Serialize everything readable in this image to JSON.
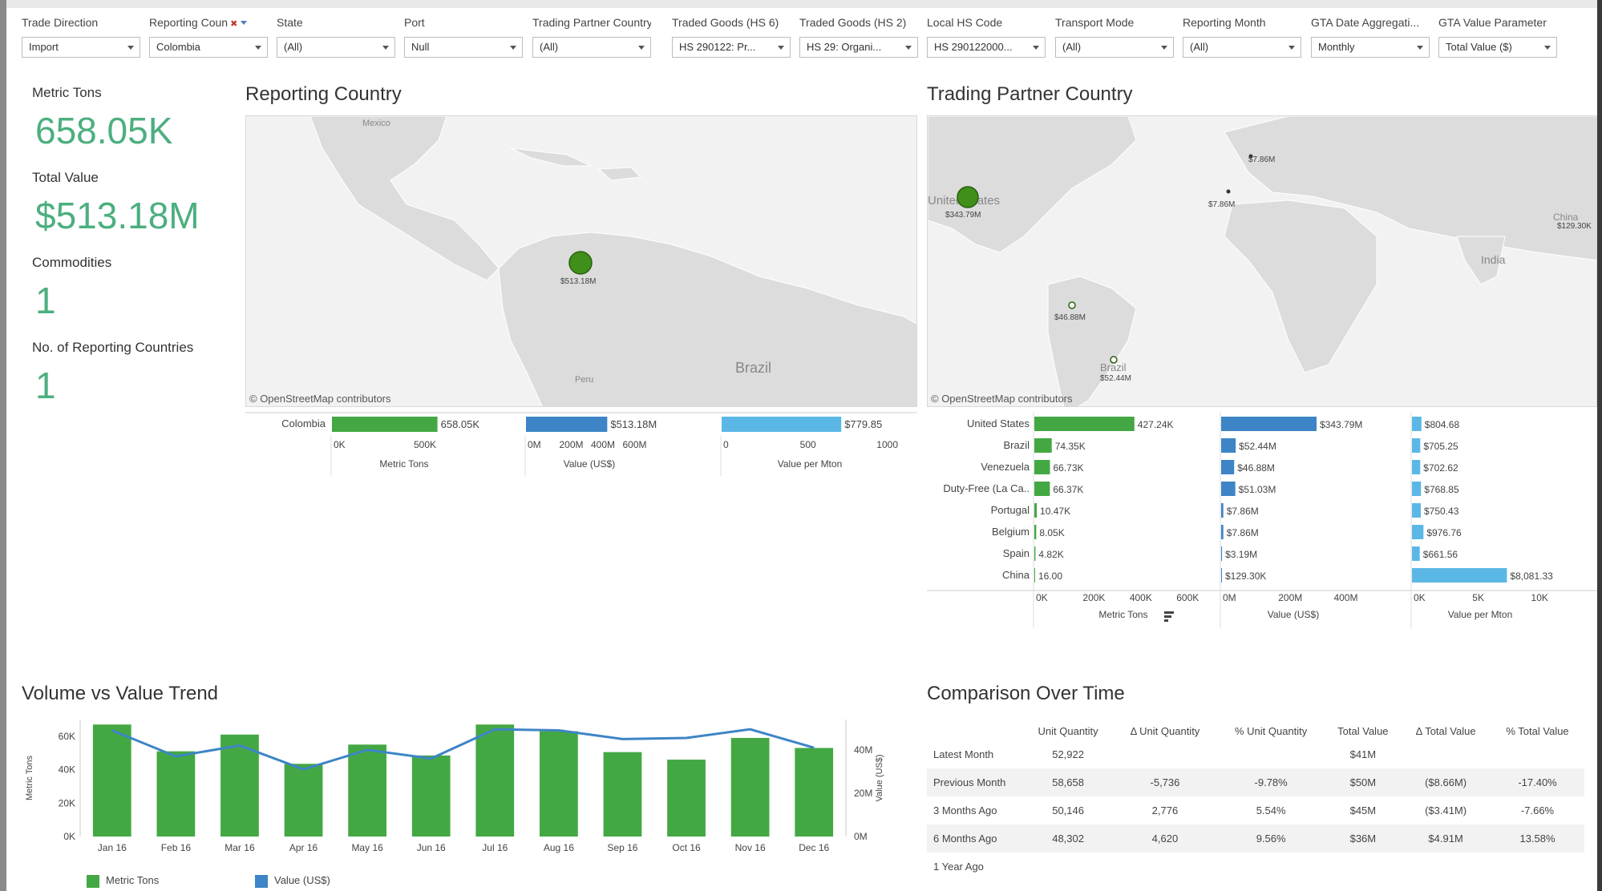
{
  "filters": [
    {
      "label": "Trade Direction",
      "value": "Import"
    },
    {
      "label": "Reporting Coun",
      "value": "Colombia"
    },
    {
      "label": "State",
      "value": "(All)"
    },
    {
      "label": "Port",
      "value": "Null"
    },
    {
      "label": "Trading Partner Country",
      "value": "(All)"
    },
    {
      "label": "Traded Goods (HS 6)",
      "value": "HS 290122: Pr..."
    },
    {
      "label": "Traded Goods (HS 2)",
      "value": "HS 29: Organi..."
    },
    {
      "label": "Local HS Code",
      "value": "HS 290122000..."
    },
    {
      "label": "Transport Mode",
      "value": "(All)"
    },
    {
      "label": "Reporting Month",
      "value": "(All)"
    },
    {
      "label": "GTA Date Aggregati...",
      "value": "Monthly"
    },
    {
      "label": "GTA Value Parameter",
      "value": "Total Value ($)"
    }
  ],
  "kpis": {
    "metric_tons_label": "Metric Tons",
    "metric_tons_value": "658.05K",
    "total_value_label": "Total Value",
    "total_value_value": "$513.18M",
    "commodities_label": "Commodities",
    "commodities_value": "1",
    "reporting_countries_label": "No. of Reporting Countries",
    "reporting_countries_value": "1"
  },
  "reporting_map": {
    "title": "Reporting Country",
    "credit": "© OpenStreetMap contributors",
    "labels": {
      "mexico": "Mexico",
      "brazil": "Brazil",
      "peru": "Peru"
    },
    "marker_label": "$513.18M"
  },
  "partner_map": {
    "title": "Trading Partner Country",
    "credit": "© OpenStreetMap contributors",
    "labels": {
      "us": "United States",
      "brazil": "Brazil",
      "china": "China",
      "india": "India"
    },
    "markers": {
      "us": "$343.79M",
      "ven": "$46.88M",
      "bra": "$52.44M",
      "por": "$7.86M",
      "bel": "$7.86M",
      "chn": "$129.30K"
    }
  },
  "reporting_bars": {
    "row": "Colombia",
    "metric_tons": 658050,
    "metric_tons_label": "658.05K",
    "value": 513180000,
    "value_label": "$513.18M",
    "per_mton": 779.85,
    "per_mton_label": "$779.85",
    "axes": [
      {
        "title": "Metric Tons",
        "ticks": [
          "0K",
          "500K"
        ]
      },
      {
        "title": "Value (US$)",
        "ticks": [
          "0M",
          "200M",
          "400M",
          "600M"
        ]
      },
      {
        "title": "Value per Mton",
        "ticks": [
          "0",
          "500",
          "1000"
        ]
      }
    ]
  },
  "partner_bars": {
    "rows": [
      {
        "country": "United States",
        "tons": 427240,
        "tons_label": "427.24K",
        "value": 343790000,
        "value_label": "$343.79M",
        "per": 804.68,
        "per_label": "$804.68"
      },
      {
        "country": "Brazil",
        "tons": 74350,
        "tons_label": "74.35K",
        "value": 52440000,
        "value_label": "$52.44M",
        "per": 705.25,
        "per_label": "$705.25"
      },
      {
        "country": "Venezuela",
        "tons": 66730,
        "tons_label": "66.73K",
        "value": 46880000,
        "value_label": "$46.88M",
        "per": 702.62,
        "per_label": "$702.62"
      },
      {
        "country": "Duty-Free (La Ca..",
        "tons": 66370,
        "tons_label": "66.37K",
        "value": 51030000,
        "value_label": "$51.03M",
        "per": 768.85,
        "per_label": "$768.85"
      },
      {
        "country": "Portugal",
        "tons": 10470,
        "tons_label": "10.47K",
        "value": 7860000,
        "value_label": "$7.86M",
        "per": 750.43,
        "per_label": "$750.43"
      },
      {
        "country": "Belgium",
        "tons": 8050,
        "tons_label": "8.05K",
        "value": 7860000,
        "value_label": "$7.86M",
        "per": 976.76,
        "per_label": "$976.76"
      },
      {
        "country": "Spain",
        "tons": 4820,
        "tons_label": "4.82K",
        "value": 3190000,
        "value_label": "$3.19M",
        "per": 661.56,
        "per_label": "$661.56"
      },
      {
        "country": "China",
        "tons": 16,
        "tons_label": "16.00",
        "value": 129300,
        "value_label": "$129.30K",
        "per": 8081.33,
        "per_label": "$8,081.33"
      }
    ],
    "axes": [
      {
        "title": "Metric Tons",
        "ticks": [
          "0K",
          "200K",
          "400K",
          "600K"
        ]
      },
      {
        "title": "Value (US$)",
        "ticks": [
          "0M",
          "200M",
          "400M"
        ]
      },
      {
        "title": "Value per Mton",
        "ticks": [
          "0K",
          "5K",
          "10K"
        ]
      }
    ]
  },
  "trend": {
    "title": "Volume vs Value Trend",
    "chart_data": {
      "type": "bar",
      "categories": [
        "Jan 16",
        "Feb 16",
        "Mar 16",
        "Apr 16",
        "May 16",
        "Jun 16",
        "Jul 16",
        "Aug 16",
        "Sep 16",
        "Oct 16",
        "Nov 16",
        "Dec 16"
      ],
      "series": [
        {
          "name": "Metric Tons",
          "type": "bar",
          "axis": "left",
          "values": [
            67000,
            51000,
            61000,
            43500,
            55000,
            48500,
            67000,
            63000,
            50500,
            46000,
            59000,
            53000
          ]
        },
        {
          "name": "Value (US$)",
          "type": "line",
          "axis": "right",
          "values": [
            49000000,
            37000000,
            42000000,
            31000000,
            40000000,
            36000000,
            49500000,
            49000000,
            45000000,
            45500000,
            49500000,
            41000000
          ]
        }
      ],
      "ylabel": "Metric Tons",
      "y2label": "Value (US$)",
      "ylim": [
        0,
        70000
      ],
      "y2lim": [
        0,
        54000000
      ],
      "yticks": [
        "0K",
        "20K",
        "40K",
        "60K"
      ],
      "y2ticks": [
        "0M",
        "20M",
        "40M"
      ],
      "colors": {
        "bar": "#43a843",
        "line": "#3d85c6"
      }
    }
  },
  "comparison": {
    "title": "Comparison Over Time",
    "headers": [
      "",
      "Unit Quantity",
      "Δ Unit Quantity",
      "% Unit Quantity",
      "Total Value",
      "Δ Total Value",
      "% Total Value"
    ],
    "rows": [
      [
        "Latest Month",
        "52,922",
        "",
        "",
        "$41M",
        "",
        ""
      ],
      [
        "Previous Month",
        "58,658",
        "-5,736",
        "-9.78%",
        "$50M",
        "($8.66M)",
        "-17.40%"
      ],
      [
        "3 Months Ago",
        "50,146",
        "2,776",
        "5.54%",
        "$45M",
        "($3.41M)",
        "-7.66%"
      ],
      [
        "6 Months Ago",
        "48,302",
        "4,620",
        "9.56%",
        "$36M",
        "$4.91M",
        "13.58%"
      ],
      [
        "1 Year Ago",
        "",
        "",
        "",
        "",
        "",
        ""
      ]
    ]
  },
  "colors": {
    "green": "#43a843",
    "blue": "#3d85c6",
    "lightblue": "#5bb8e6",
    "kpi": "#4caf7f",
    "marker": "#3f8f1a"
  }
}
